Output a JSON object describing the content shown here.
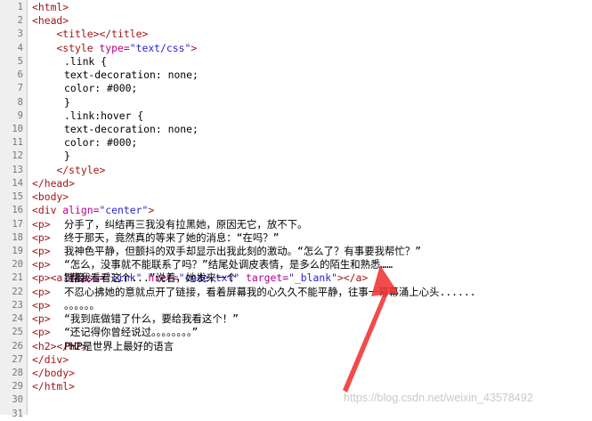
{
  "editor": {
    "lines": [
      {
        "n": "1",
        "indent": "",
        "parts": [
          [
            "tag",
            "<html>"
          ]
        ]
      },
      {
        "n": "2",
        "indent": "",
        "parts": [
          [
            "tag",
            "<head>"
          ]
        ]
      },
      {
        "n": "3",
        "indent": "    ",
        "parts": [
          [
            "tag",
            "<title></title>"
          ]
        ]
      },
      {
        "n": "4",
        "indent": "    ",
        "parts": [
          [
            "tag",
            "<style "
          ],
          [
            "attr",
            "type="
          ],
          [
            "val",
            "\"text/css\""
          ],
          [
            "tag",
            ">"
          ]
        ]
      },
      {
        "n": "5",
        "indent": "    ",
        "parts": [
          [
            "txt",
            ".link {"
          ]
        ]
      },
      {
        "n": "6",
        "indent": "        ",
        "parts": [
          [
            "txt",
            "text-decoration: none;"
          ]
        ]
      },
      {
        "n": "7",
        "indent": "        ",
        "parts": [
          [
            "txt",
            "color: #000;"
          ]
        ]
      },
      {
        "n": "8",
        "indent": "    ",
        "parts": [
          [
            "txt",
            "}"
          ]
        ]
      },
      {
        "n": "9",
        "indent": "    ",
        "parts": [
          [
            "txt",
            ".link:hover {"
          ]
        ]
      },
      {
        "n": "10",
        "indent": "        ",
        "parts": [
          [
            "txt",
            "text-decoration: none;"
          ]
        ]
      },
      {
        "n": "11",
        "indent": "        ",
        "parts": [
          [
            "txt",
            "color: #000;"
          ]
        ]
      },
      {
        "n": "12",
        "indent": "    ",
        "parts": [
          [
            "txt",
            "}"
          ]
        ]
      },
      {
        "n": "13",
        "indent": "    ",
        "parts": [
          [
            "tag",
            "</style>"
          ]
        ]
      },
      {
        "n": "14",
        "indent": "",
        "parts": [
          [
            "tag",
            "</head>"
          ]
        ]
      },
      {
        "n": "15",
        "indent": "",
        "parts": [
          [
            "tag",
            "<body>"
          ]
        ]
      },
      {
        "n": "16",
        "indent": "",
        "parts": [
          [
            "tag",
            "<div "
          ],
          [
            "attr",
            "align="
          ],
          [
            "val",
            "\"center\""
          ],
          [
            "tag",
            ">"
          ]
        ]
      },
      {
        "n": "17",
        "indent": "",
        "parts": [
          [
            "tag",
            "<p>"
          ],
          [
            "txt",
            "分手了，纠结再三我没有拉黑她，原因无它，放不下。"
          ]
        ]
      },
      {
        "n": "18",
        "indent": "",
        "parts": [
          [
            "tag",
            "<p>"
          ],
          [
            "txt",
            "终于那天，竟然真的等来了她的消息：“在吗？”"
          ]
        ]
      },
      {
        "n": "19",
        "indent": "",
        "parts": [
          [
            "tag",
            "<p>"
          ],
          [
            "txt",
            "我神色平静，但颤抖的双手却显示出我此刻的激动。“怎么了？有事要我帮忙？”"
          ]
        ]
      },
      {
        "n": "20",
        "indent": "",
        "parts": [
          [
            "tag",
            "<p>"
          ],
          [
            "txt",
            "“怎么，没事就不能联系了吗？”结尾处调皮表情，是多么的陌生和熟悉……"
          ]
        ]
      },
      {
        "n": "21",
        "indent": "",
        "parts": [
          [
            "tag",
            "<p>"
          ],
          [
            "txt",
            "“帮我看看这个...”说着，她发来一个"
          ],
          [
            "tag",
            "<a "
          ],
          [
            "attr",
            "class="
          ],
          [
            "val",
            "\"link\" "
          ],
          [
            "attr",
            "href="
          ],
          [
            "val",
            "\"code.txt\" "
          ],
          [
            "attr",
            "target="
          ],
          [
            "val",
            "\"_blank\""
          ],
          [
            "tag",
            ">"
          ],
          [
            "txt",
            "链接"
          ],
          [
            "tag",
            "</a>"
          ],
          [
            "txt",
            "。"
          ]
        ]
      },
      {
        "n": "22",
        "indent": "",
        "parts": [
          [
            "tag",
            "<p>"
          ],
          [
            "txt",
            "不忍心拂她的意就点开了链接，看着屏幕我的心久久不能平静，往事一幕幕涌上心头......"
          ]
        ]
      },
      {
        "n": "23",
        "indent": "",
        "parts": [
          [
            "tag",
            "<p>"
          ],
          [
            "txt",
            "。。。。。。"
          ]
        ]
      },
      {
        "n": "24",
        "indent": "",
        "parts": [
          [
            "tag",
            "<p>"
          ],
          [
            "txt",
            "“我到底做错了什么，要给我看这个！”"
          ]
        ]
      },
      {
        "n": "25",
        "indent": "",
        "parts": [
          [
            "tag",
            "<p>"
          ],
          [
            "txt",
            "“还记得你曾经说过。。。。。。。。”"
          ]
        ]
      },
      {
        "n": "26",
        "indent": "",
        "parts": [
          [
            "tag",
            "<h2>"
          ],
          [
            "txt",
            "PHP是世界上最好的语言"
          ],
          [
            "tag",
            "</h2>"
          ]
        ]
      },
      {
        "n": "27",
        "indent": "",
        "parts": [
          [
            "tag",
            "</div>"
          ]
        ]
      },
      {
        "n": "28",
        "indent": "",
        "parts": [
          [
            "tag",
            "</body>"
          ]
        ]
      },
      {
        "n": "29",
        "indent": "",
        "parts": [
          [
            "tag",
            "</html>"
          ]
        ]
      },
      {
        "n": "30",
        "indent": "",
        "parts": []
      },
      {
        "n": "31",
        "indent": "",
        "parts": []
      }
    ]
  },
  "watermark": "https://blog.csdn.net/weixin_43578492",
  "colors": {
    "tag": "#a31515",
    "attribute": "#b5008a",
    "value": "#2b22cc",
    "text": "#000000",
    "gutter_bg": "#efefef",
    "line_number": "#777777",
    "arrow": "#f03232"
  },
  "annotation": {
    "icon": "red-arrow-icon"
  }
}
